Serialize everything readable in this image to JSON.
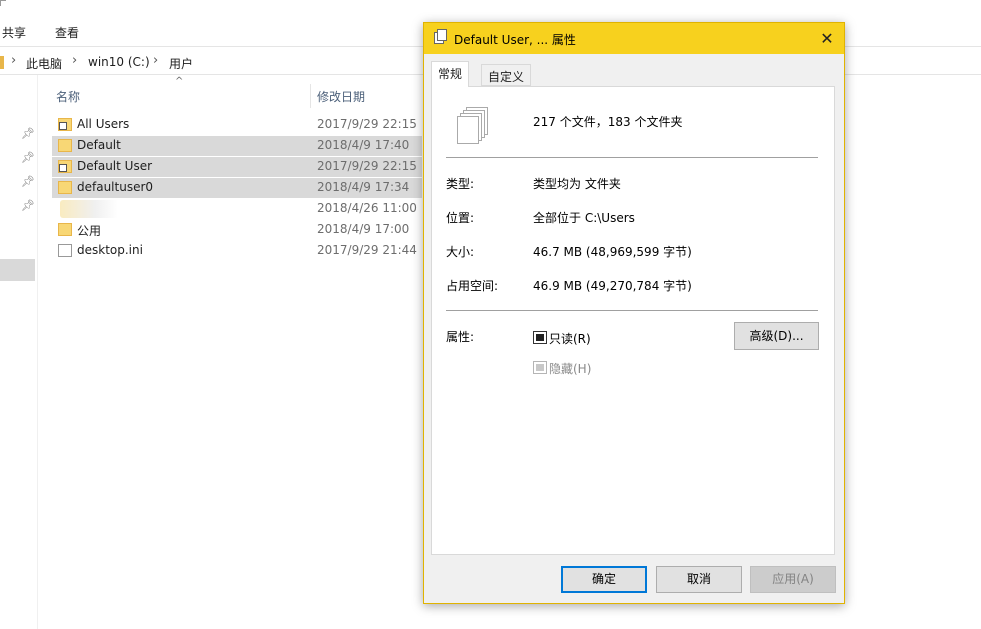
{
  "explorer": {
    "ribbon_tabs": [
      {
        "label": "共享"
      },
      {
        "label": "查看"
      }
    ],
    "breadcrumb": [
      {
        "label": "此电脑"
      },
      {
        "label": "win10 (C:)"
      },
      {
        "label": "用户"
      }
    ],
    "columns": {
      "name": "名称",
      "modified": "修改日期"
    },
    "rows": [
      {
        "name": "All Users",
        "date": "2017/9/29 22:15",
        "selected": false
      },
      {
        "name": "Default",
        "date": "2018/4/9 17:40",
        "selected": true
      },
      {
        "name": "Default User",
        "date": "2017/9/29 22:15",
        "selected": true
      },
      {
        "name": "defaultuser0",
        "date": "2018/4/9 17:34",
        "selected": true
      },
      {
        "name": "",
        "date": "2018/4/26 11:00",
        "selected": false
      },
      {
        "name": "公用",
        "date": "2018/4/9 17:00",
        "selected": false
      },
      {
        "name": "desktop.ini",
        "date": "2017/9/29 21:44",
        "selected": false
      }
    ]
  },
  "dialog": {
    "title": "Default User, ... 属性",
    "tabs": [
      {
        "label": "常规"
      },
      {
        "label": "自定义"
      }
    ],
    "summary": "217 个文件，183 个文件夹",
    "fields": {
      "type_label": "类型:",
      "type_value": "类型均为 文件夹",
      "location_label": "位置:",
      "location_value": "全部位于 C:\\Users",
      "size_label": "大小:",
      "size_value": "46.7 MB (48,969,599 字节)",
      "disk_label": "占用空间:",
      "disk_value": "46.9 MB (49,270,784 字节)"
    },
    "attributes": {
      "label": "属性:",
      "readonly_label": "只读(R)",
      "readonly_state": "indeterminate",
      "hidden_label": "隐藏(H)",
      "hidden_state": "indeterminate-disabled",
      "advanced_label": "高级(D)..."
    },
    "buttons": {
      "ok": "确定",
      "cancel": "取消",
      "apply": "应用(A)"
    }
  }
}
